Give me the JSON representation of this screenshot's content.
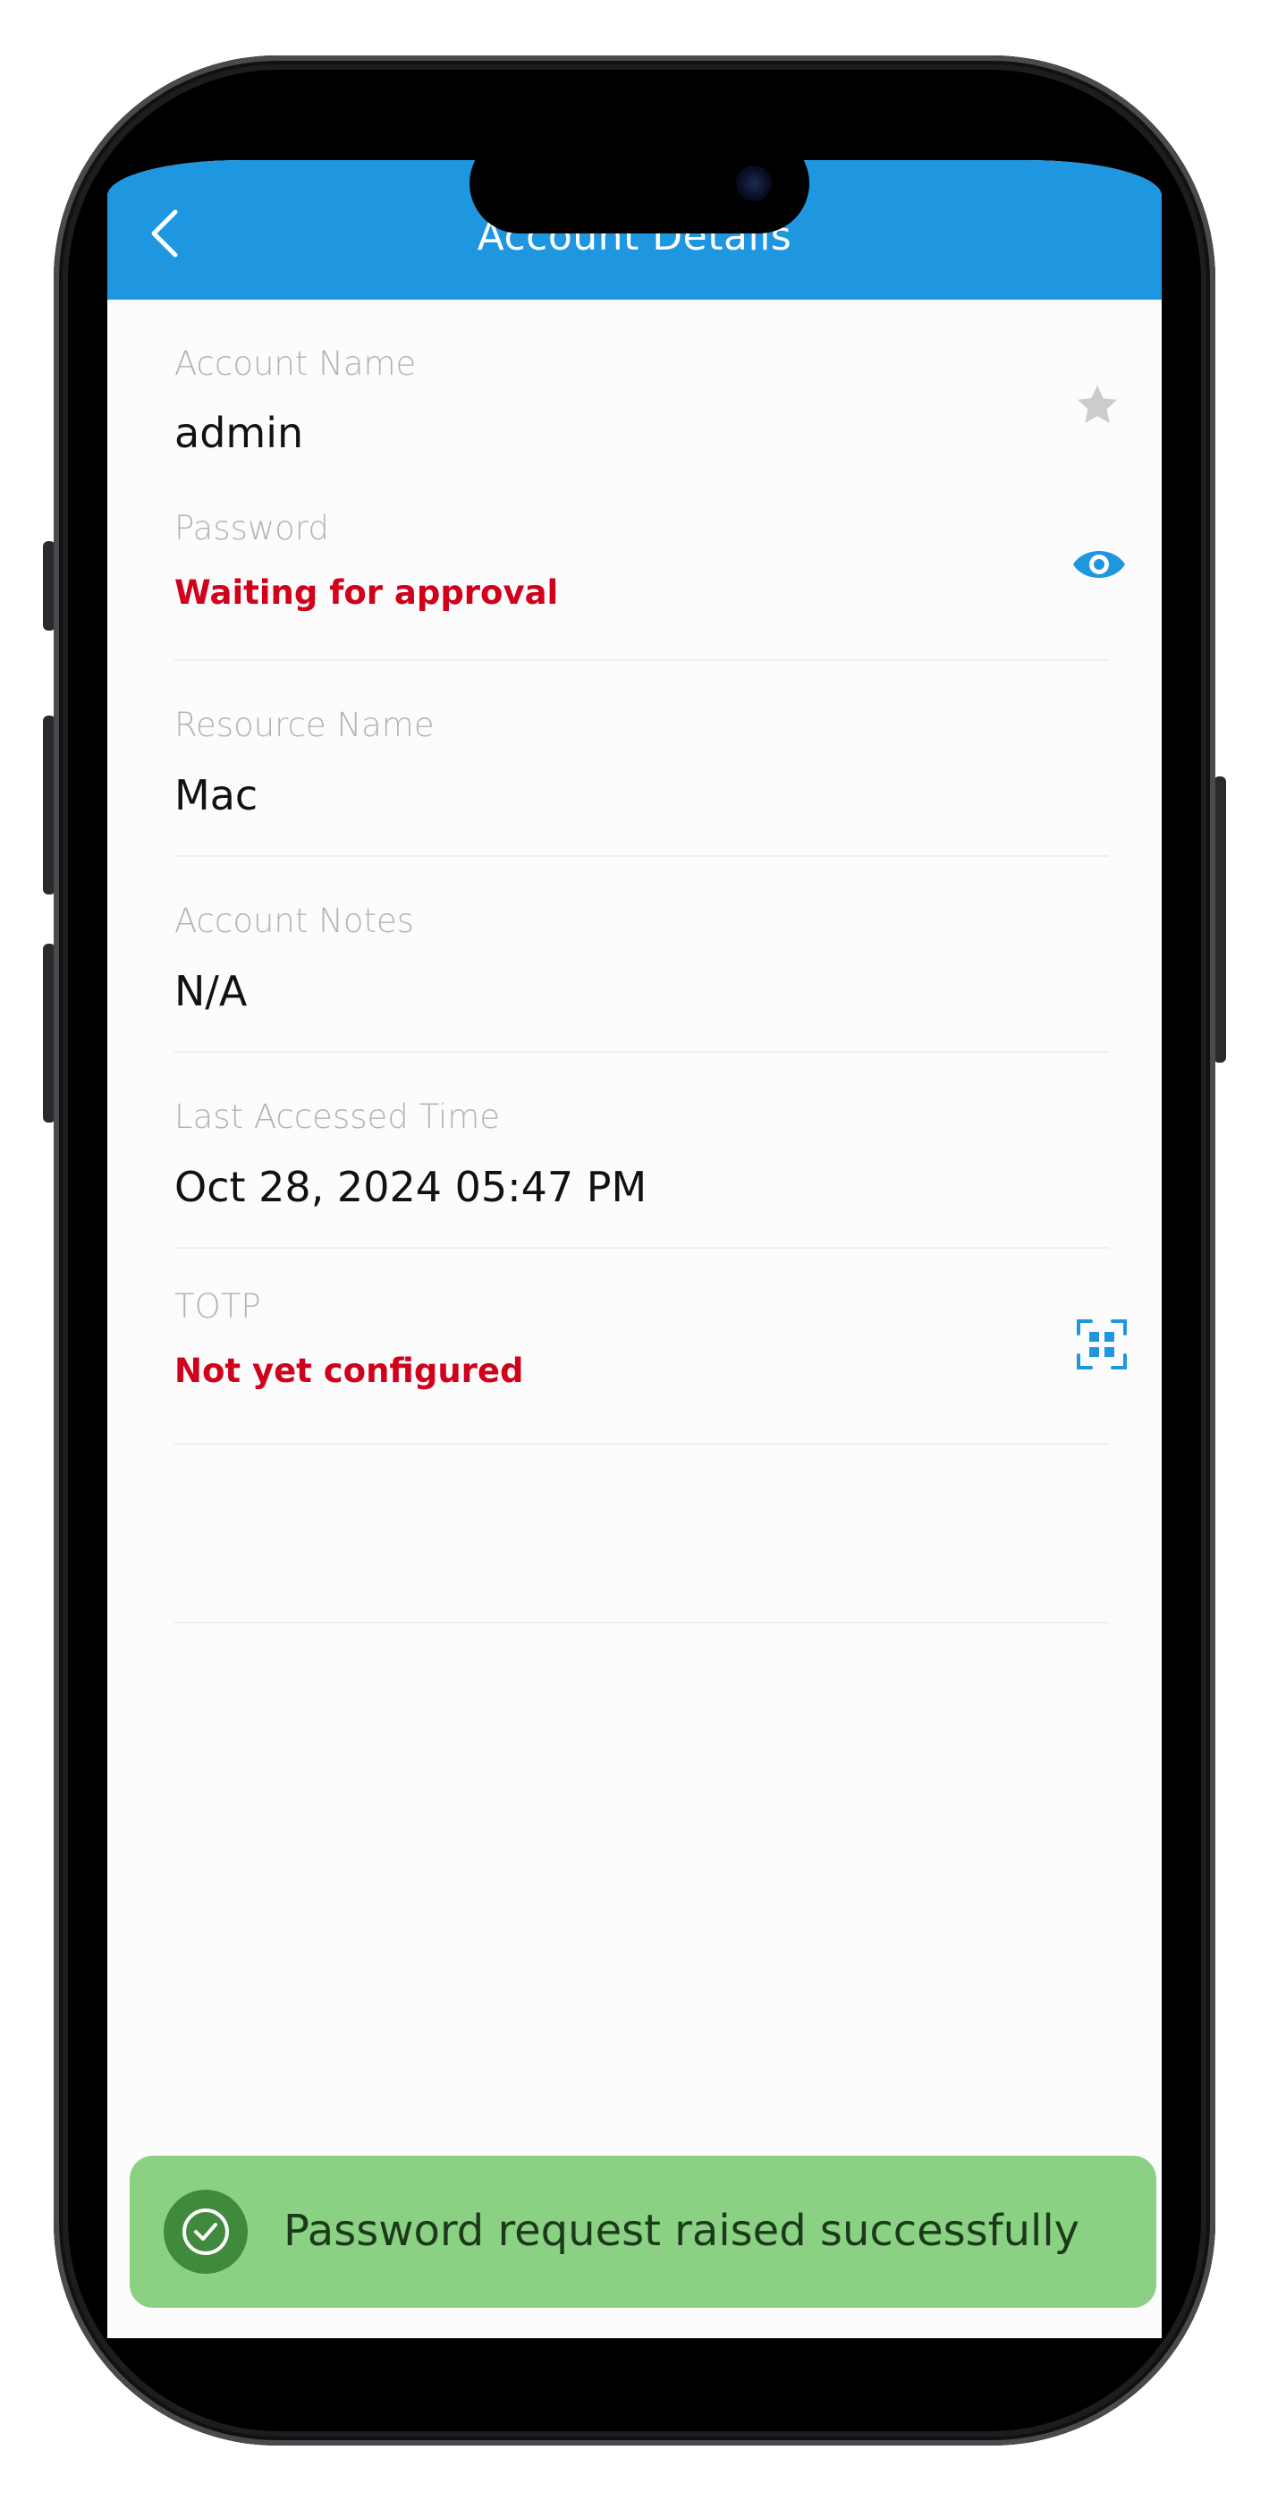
{
  "nav": {
    "title": "Account Details",
    "back_icon": "chevron-left-icon"
  },
  "details": [
    {
      "label": "Account Name",
      "value": "admin",
      "value_style": "normal",
      "icon": "star-icon"
    },
    {
      "label": "Password",
      "value": "Waiting for approval",
      "value_style": "status",
      "icon": "eye-icon"
    },
    {
      "label": "Resource Name",
      "value": "Mac",
      "value_style": "normal",
      "icon": ""
    },
    {
      "label": "Account Notes",
      "value": "N/A",
      "value_style": "normal",
      "icon": ""
    },
    {
      "label": "Last Accessed Time",
      "value": "Oct 28, 2024 05:47 PM",
      "value_style": "normal",
      "icon": ""
    },
    {
      "label": "TOTP",
      "value": "Not yet configured",
      "value_style": "status",
      "icon": "qr-scan-icon"
    }
  ],
  "toast": {
    "message": "Password request raised successfully",
    "icon": "check-circle-icon"
  },
  "colors": {
    "nav_bg": "#1e97e0",
    "status_red": "#d0021b",
    "toast_bg": "#8ad184",
    "toast_icon_bg": "#3f8a3c",
    "accent_blue": "#1e97e0",
    "star_gray": "#cccccc"
  }
}
